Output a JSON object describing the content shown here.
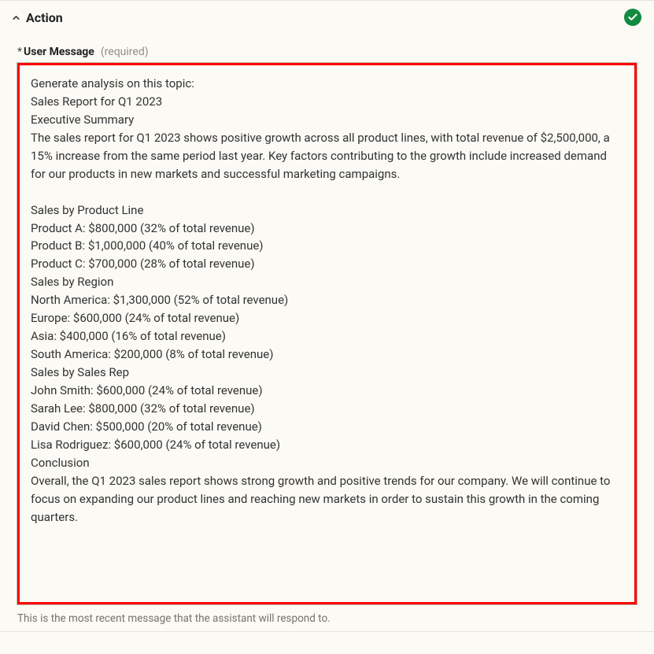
{
  "panel": {
    "title": "Action"
  },
  "field": {
    "label": "User Message",
    "required_tag": "(required)",
    "asterisk": "*",
    "helper": "This is the most recent message that the assistant will respond to.",
    "value": "Generate analysis on this topic:\nSales Report for Q1 2023\nExecutive Summary\nThe sales report for Q1 2023 shows positive growth across all product lines, with total revenue of $2,500,000, a 15% increase from the same period last year. Key factors contributing to the growth include increased demand for our products in new markets and successful marketing campaigns.\n\nSales by Product Line\nProduct A: $800,000 (32% of total revenue)\nProduct B: $1,000,000 (40% of total revenue)\nProduct C: $700,000 (28% of total revenue)\nSales by Region\nNorth America: $1,300,000 (52% of total revenue)\nEurope: $600,000 (24% of total revenue)\nAsia: $400,000 (16% of total revenue)\nSouth America: $200,000 (8% of total revenue)\nSales by Sales Rep\nJohn Smith: $600,000 (24% of total revenue)\nSarah Lee: $800,000 (32% of total revenue)\nDavid Chen: $500,000 (20% of total revenue)\nLisa Rodriguez: $600,000 (24% of total revenue)\nConclusion\nOverall, the Q1 2023 sales report shows strong growth and positive trends for our company. We will continue to focus on expanding our product lines and reaching new markets in order to sustain this growth in the coming quarters."
  }
}
